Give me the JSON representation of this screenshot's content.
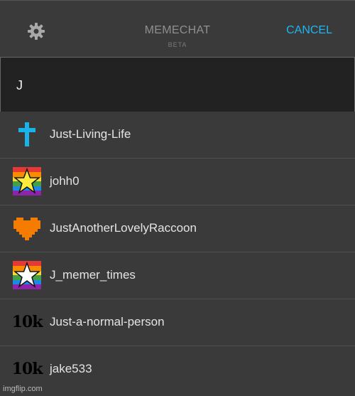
{
  "header": {
    "title": "MEMECHAT",
    "subtitle": "BETA",
    "cancel_label": "CANCEL"
  },
  "search": {
    "value": "J"
  },
  "users": [
    {
      "name": "Just-Living-Life",
      "icon": "cross-icon"
    },
    {
      "name": "johh0",
      "icon": "rainbow-star-icon"
    },
    {
      "name": "JustAnotherLovelyRaccoon",
      "icon": "pixel-heart-icon"
    },
    {
      "name": "J_memer_times",
      "icon": "rainbow-star-icon"
    },
    {
      "name": "Just-a-normal-person",
      "icon": "10k-badge-icon",
      "badge_text": "10k"
    },
    {
      "name": "jake533",
      "icon": "10k-badge-icon",
      "badge_text": "10k"
    }
  ],
  "watermark": "imgflip.com",
  "colors": {
    "accent": "#1fb6ef",
    "background": "#3a3a3a",
    "search_bg": "#222222"
  }
}
